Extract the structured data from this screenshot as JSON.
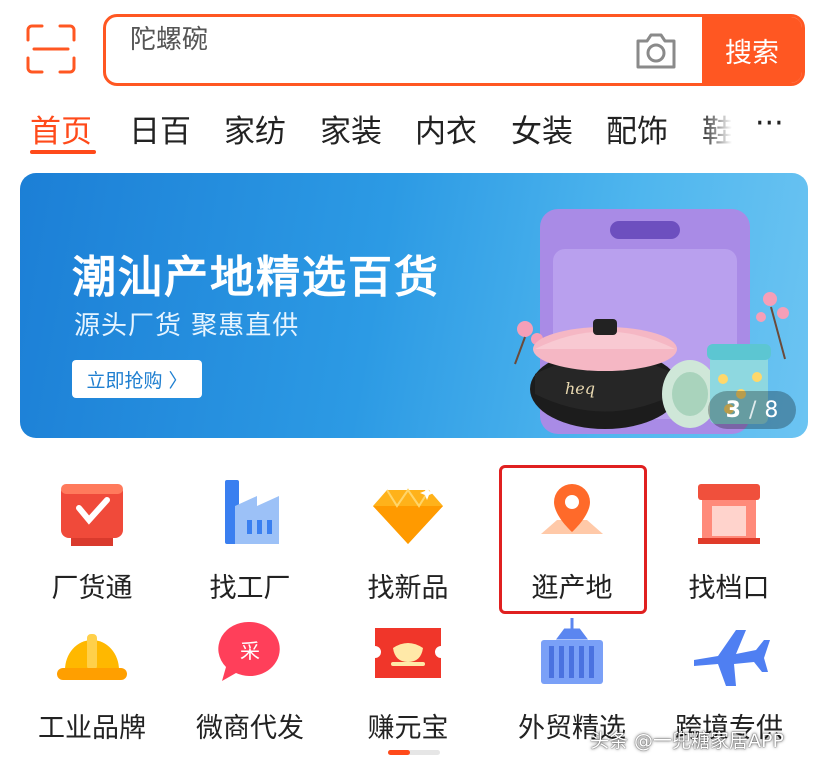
{
  "search": {
    "query": "陀螺碗",
    "button_label": "搜索"
  },
  "tabs": {
    "items": [
      "首页",
      "日百",
      "家纺",
      "家装",
      "内衣",
      "女装",
      "配饰",
      "鞋"
    ],
    "active_index": 0,
    "more_label": "···"
  },
  "banner": {
    "title": "潮汕产地精选百货",
    "subtitle": "源头厂货 聚惠直供",
    "cta_label": "立即抢购 〉",
    "page_current": "3",
    "page_total": "8",
    "page_sep": "/"
  },
  "grid": {
    "row1": [
      {
        "label": "厂货通",
        "icon": "factory-goods-icon"
      },
      {
        "label": "找工厂",
        "icon": "factory-building-icon"
      },
      {
        "label": "找新品",
        "icon": "diamond-icon"
      },
      {
        "label": "逛产地",
        "icon": "location-pin-icon"
      },
      {
        "label": "找档口",
        "icon": "storefront-icon"
      }
    ],
    "row2": [
      {
        "label": "工业品牌",
        "icon": "hard-hat-icon"
      },
      {
        "label": "微商代发",
        "icon": "chat-bubble-icon"
      },
      {
        "label": "赚元宝",
        "icon": "gold-ingot-ticket-icon"
      },
      {
        "label": "外贸精选",
        "icon": "shipping-container-icon"
      },
      {
        "label": "跨境专供",
        "icon": "airplane-icon"
      }
    ]
  },
  "colors": {
    "accent": "#ff5722",
    "tab_active": "#ff4a1a",
    "banner_blue": "#2c9ae4",
    "highlight_red": "#e02020"
  },
  "watermark": "头条 @一兜糖家居APP"
}
